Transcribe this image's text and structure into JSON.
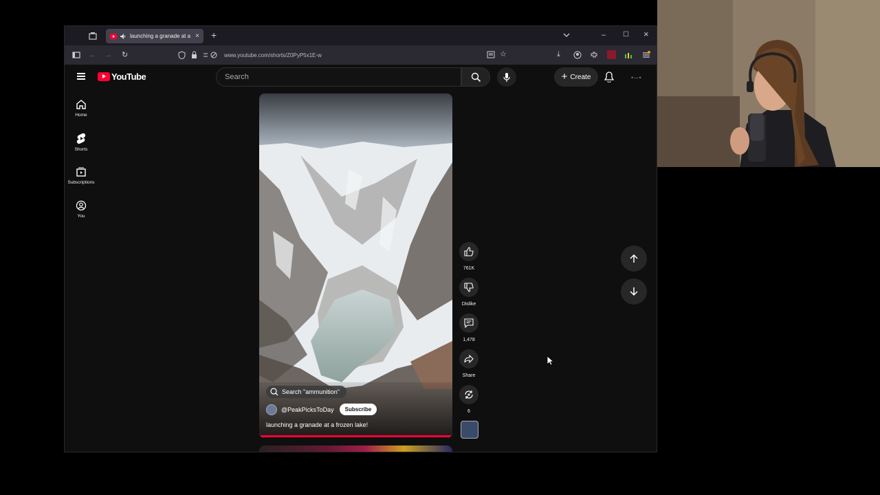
{
  "browser": {
    "tab_title": "launching a granade at a fr",
    "url": "www.youtube.com/shorts/Z0PyP5x1E-w",
    "new_tab_symbol": "+"
  },
  "youtube": {
    "logo_text": "YouTube",
    "search_placeholder": "Search",
    "create_label": "Create",
    "sidebar": [
      {
        "label": "Home",
        "icon": "home-icon"
      },
      {
        "label": "Shorts",
        "icon": "shorts-icon"
      },
      {
        "label": "Subscriptions",
        "icon": "subscriptions-icon"
      },
      {
        "label": "You",
        "icon": "you-icon"
      }
    ],
    "short": {
      "search_chip": "Search \"ammunition\"",
      "channel": "@PeakPicksToDay",
      "subscribe_label": "Subscribe",
      "title": "launching a granade at a frozen lake!"
    },
    "actions": {
      "likes": "761K",
      "dislike_label": "Dislike",
      "comments": "1,478",
      "share_label": "Share",
      "remix_count": "6"
    }
  },
  "colors": {
    "brand_red": "#ff0033",
    "page_bg": "#0f0f0f",
    "button_bg": "#272727"
  }
}
